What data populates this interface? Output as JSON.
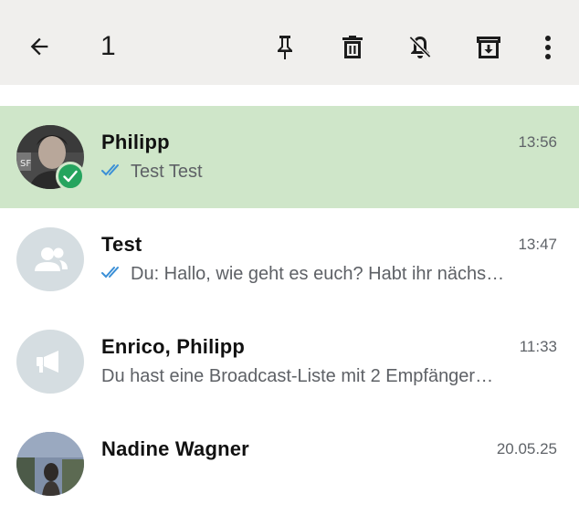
{
  "toolbar": {
    "back_icon": "arrow-left-icon",
    "selected_count": "1",
    "actions": [
      "pin-icon",
      "delete-icon",
      "mute-icon",
      "archive-icon",
      "more-vert-icon"
    ],
    "background": "#f0efed"
  },
  "chats": [
    {
      "name": "Philipp",
      "time": "13:56",
      "preview": "Test Test",
      "read_ticks": true,
      "selected": true,
      "avatar": "photo"
    },
    {
      "name": "Test",
      "time": "13:47",
      "preview": "Du: Hallo, wie geht es euch? Habt ihr nächs…",
      "read_ticks": true,
      "selected": false,
      "avatar": "group-icon"
    },
    {
      "name": "Enrico, Philipp",
      "time": "11:33",
      "preview": "Du hast eine Broadcast-Liste mit 2 Empfänger…",
      "read_ticks": false,
      "selected": false,
      "avatar": "broadcast-icon"
    },
    {
      "name": "Nadine Wagner",
      "time": "20.05.25",
      "preview": "",
      "read_ticks": false,
      "selected": false,
      "avatar": "photo"
    }
  ],
  "colors": {
    "selected_row": "#cfe6c9",
    "check_badge": "#25a45e",
    "read_ticks": "#3a8fd6",
    "placeholder_avatar": "#d5dde1"
  }
}
